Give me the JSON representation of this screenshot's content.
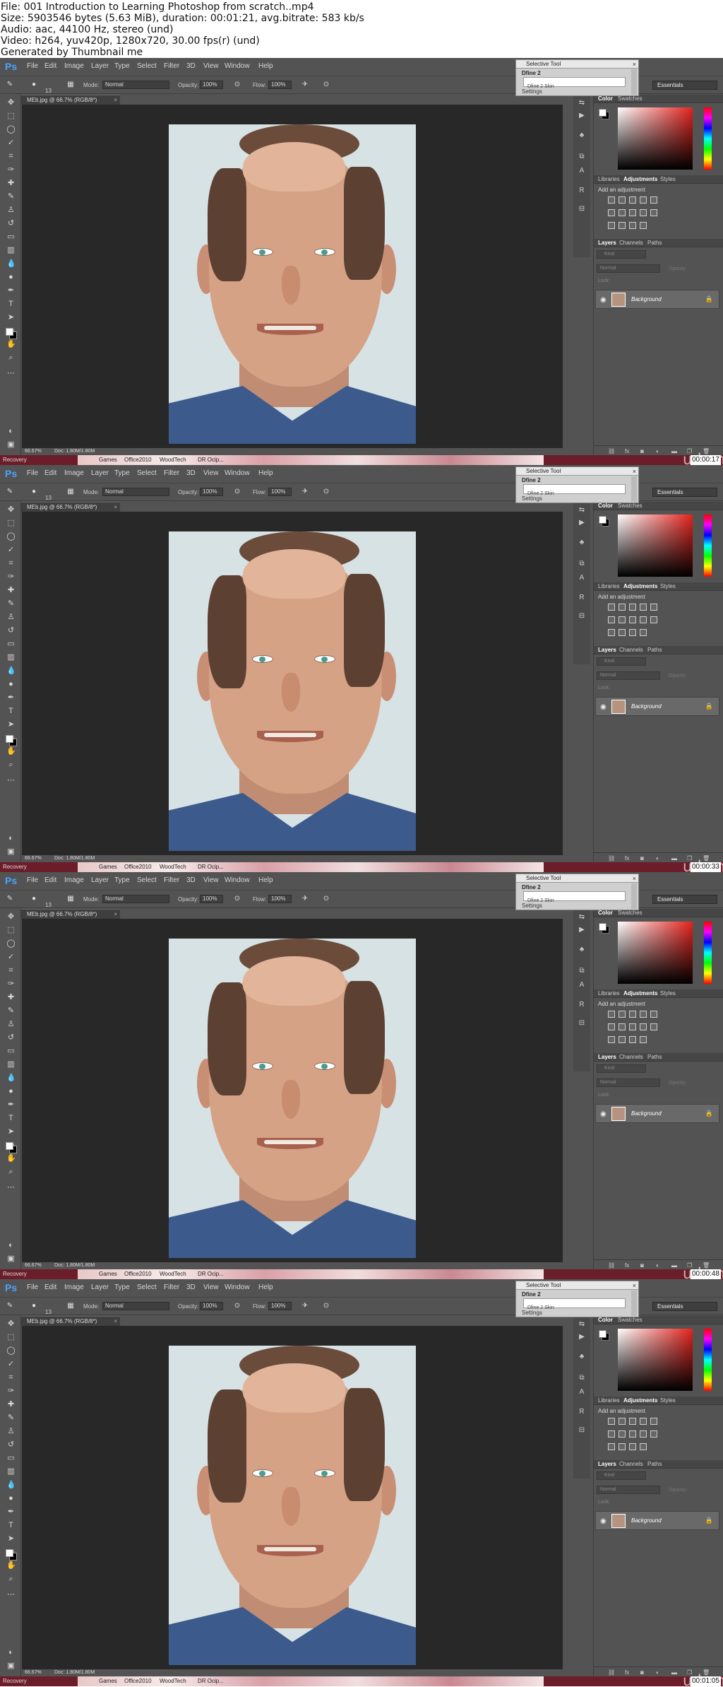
{
  "header": {
    "file": "File: 001 Introduction to Learning Photoshop from scratch..mp4",
    "size": "Size: 5903546 bytes (5.63 MiB), duration: 00:01:21, avg.bitrate: 583 kb/s",
    "audio": "Audio: aac, 44100 Hz, stereo (und)",
    "video": "Video: h264, yuv420p, 1280x720, 30.00 fps(r) (und)",
    "generated": "Generated by Thumbnail me"
  },
  "app": {
    "logo": "Ps",
    "menu": [
      "File",
      "Edit",
      "Image",
      "Layer",
      "Type",
      "Select",
      "Filter",
      "3D",
      "View",
      "Window",
      "Help"
    ],
    "selective_tool": {
      "title": "Selective Tool",
      "mode": "Dfine 2",
      "hidden": "Dfine 2          Skin",
      "settings": "Settings"
    },
    "options": {
      "brush_size": "13",
      "mode_label": "Mode:",
      "mode_value": "Normal",
      "opacity_label": "Opacity:",
      "opacity_value": "100%",
      "flow_label": "Flow:",
      "flow_value": "100%"
    },
    "workspace": "Essentials",
    "doc_tab": "MEb.jpg @ 66.7% (RGB/8*)",
    "status_zoom": "66.67%",
    "status_doc": "Doc: 1.80M/1.80M",
    "panels": {
      "color_tabs": [
        "Color",
        "Swatches"
      ],
      "adj_tabs": [
        "Libraries",
        "Adjustments",
        "Styles"
      ],
      "adj_title": "Add an adjustment",
      "layers_tabs": [
        "Layers",
        "Channels",
        "Paths"
      ],
      "find_placeholder": "Kind",
      "blend_mode": "Normal",
      "opacity_label": "Opacity:",
      "lock_label": "Lock:",
      "layer_name": "Background"
    },
    "taskbar": [
      "Recovery",
      "Games",
      "Office2010",
      "WoodTech",
      "DR Ocip..."
    ],
    "watermark": "udemy"
  },
  "frames": [
    {
      "timestamp": "00:00:17"
    },
    {
      "timestamp": "00:00:33"
    },
    {
      "timestamp": "00:00:48"
    },
    {
      "timestamp": "00:01:05"
    }
  ]
}
